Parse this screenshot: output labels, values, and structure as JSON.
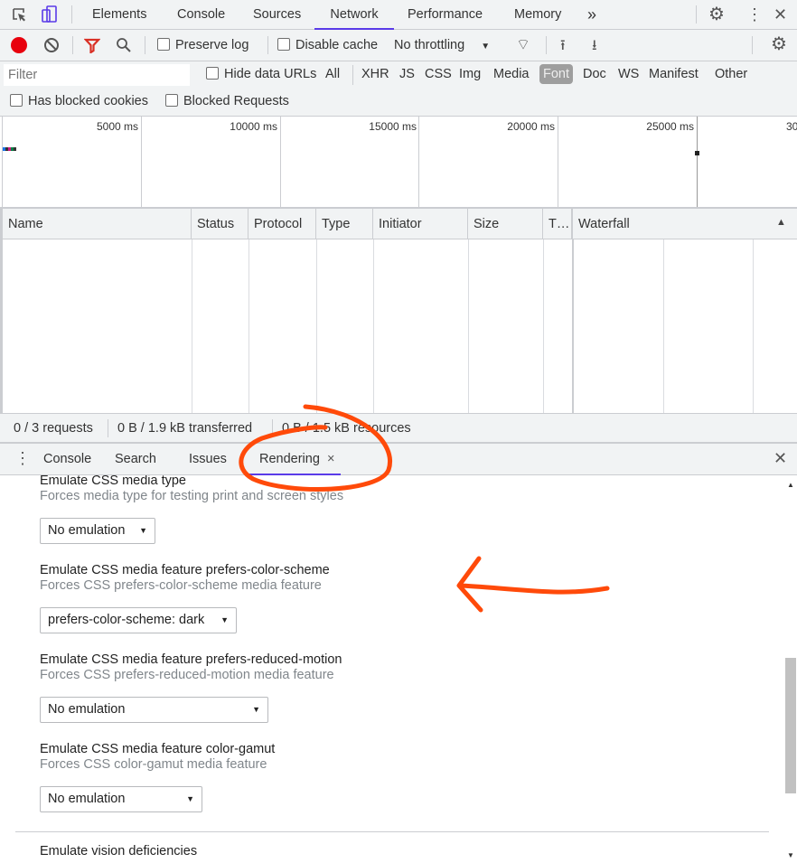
{
  "tabs": [
    "Elements",
    "Console",
    "Sources",
    "Network",
    "Performance",
    "Memory"
  ],
  "active_tab": "Network",
  "toolbar": {
    "preserve_log": "Preserve log",
    "disable_cache": "Disable cache",
    "throttling": "No throttling"
  },
  "filter": {
    "placeholder": "Filter",
    "hide_data_urls": "Hide data URLs",
    "types": [
      "All",
      "XHR",
      "JS",
      "CSS",
      "Img",
      "Media",
      "Font",
      "Doc",
      "WS",
      "Manifest",
      "Other"
    ],
    "active_type": "Font",
    "has_blocked_cookies": "Has blocked cookies",
    "blocked_requests": "Blocked Requests"
  },
  "timeline": {
    "ticks": [
      "5000 ms",
      "10000 ms",
      "15000 ms",
      "20000 ms",
      "25000 ms",
      "30"
    ]
  },
  "table": {
    "columns": [
      "Name",
      "Status",
      "Protocol",
      "Type",
      "Initiator",
      "Size",
      "T…",
      "Waterfall"
    ]
  },
  "status": {
    "requests": "0 / 3 requests",
    "transferred": "0 B / 1.9 kB transferred",
    "resources": "0 B / 1.5 kB resources"
  },
  "drawer": {
    "tabs": [
      "Console",
      "Search",
      "Issues",
      "Rendering"
    ],
    "active": "Rendering",
    "close_tab": "×"
  },
  "rendering": {
    "sections": [
      {
        "title": "Emulate CSS media type",
        "desc": "Forces media type for testing print and screen styles",
        "value": "No emulation"
      },
      {
        "title": "Emulate CSS media feature prefers-color-scheme",
        "desc": "Forces CSS prefers-color-scheme media feature",
        "value": "prefers-color-scheme: dark"
      },
      {
        "title": "Emulate CSS media feature prefers-reduced-motion",
        "desc": "Forces CSS prefers-reduced-motion media feature",
        "value": "No emulation"
      },
      {
        "title": "Emulate CSS media feature color-gamut",
        "desc": "Forces CSS color-gamut media feature",
        "value": "No emulation"
      },
      {
        "title": "Emulate vision deficiencies"
      }
    ]
  },
  "colors": {
    "accent": "#5a3be8",
    "record": "#e8000d",
    "filter_icon": "#d93025",
    "annotation": "#ff4a0a"
  }
}
